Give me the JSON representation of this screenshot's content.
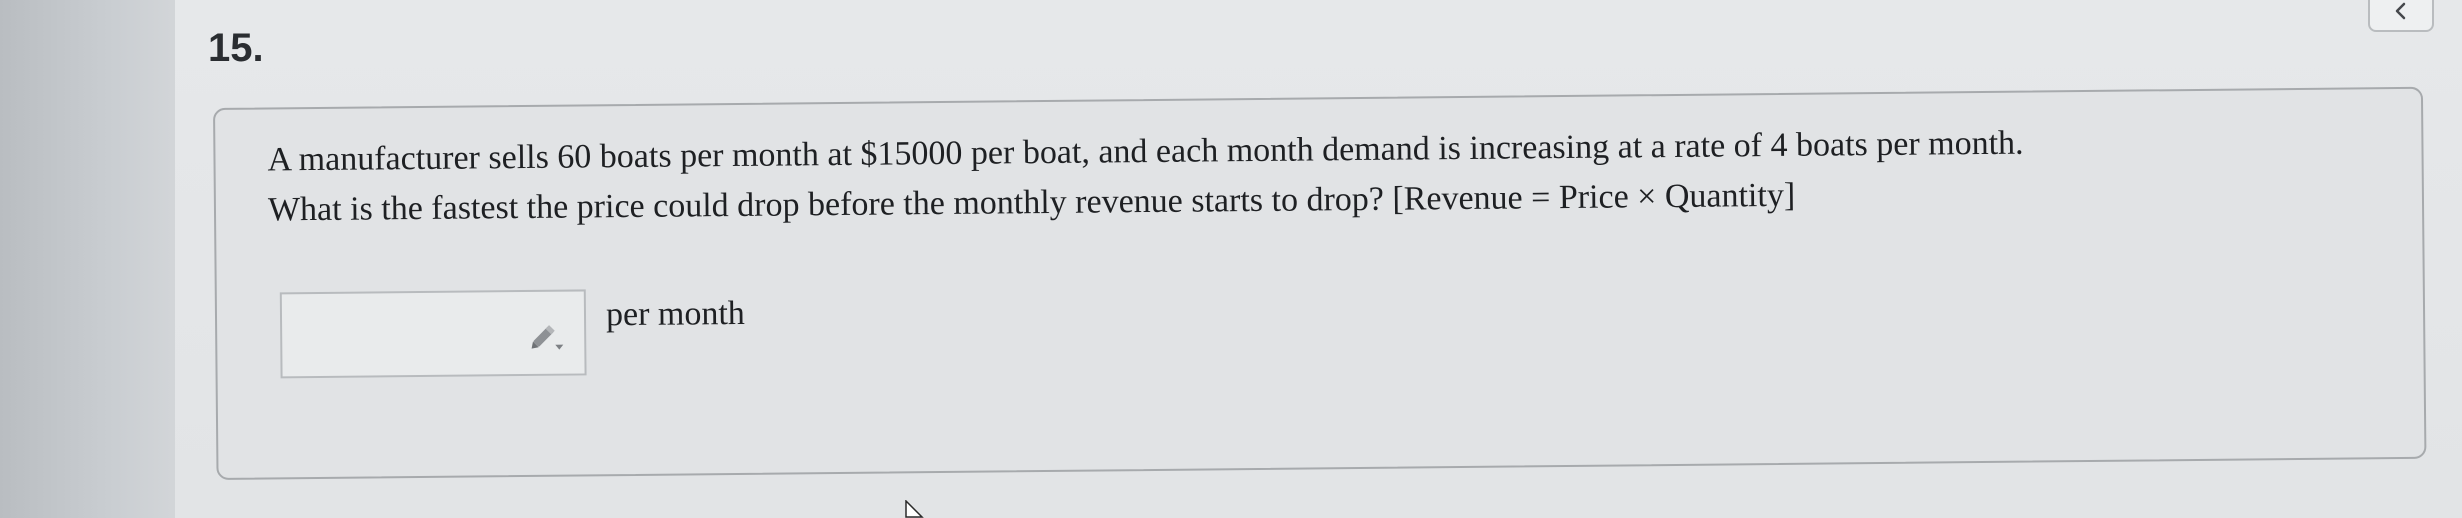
{
  "question": {
    "number": "15.",
    "text_line_1": "A manufacturer sells 60 boats per month at $15000 per boat, and each month demand is increasing at a rate of 4 boats per month.",
    "text_line_2": "What is the fastest the price could drop before the monthly revenue starts to drop? [Revenue = Price × Quantity]"
  },
  "answer": {
    "value": "",
    "placeholder": "",
    "unit": "per month",
    "edit_icon": "pencil-dropdown-icon"
  },
  "controls": {
    "collapse_icon": "chevron-left-icon"
  },
  "colors": {
    "page_background": "#e2e4e6",
    "card_border": "#a7aaad",
    "text": "#1e2023"
  }
}
